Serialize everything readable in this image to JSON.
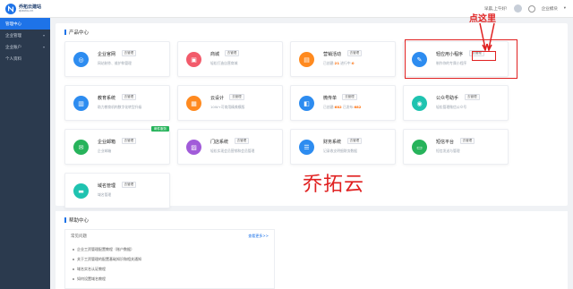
{
  "header": {
    "logo_cn": "乔拓云建站",
    "logo_en": "qiaotu.cn",
    "greeting": "早晨,上午好!",
    "account_menu": "企业模块"
  },
  "sidebar": {
    "items": [
      {
        "label": "管理中心",
        "active": true
      },
      {
        "label": "企业管理",
        "active": false
      },
      {
        "label": "企业账户",
        "active": false
      },
      {
        "label": "个人资料",
        "active": false
      }
    ]
  },
  "product_center": {
    "title": "产品中心",
    "cards": [
      {
        "name": "企业官网",
        "tag": "去管理",
        "sub": "网站制作、维护和管理",
        "icon": "globe-icon",
        "color": "#2d8cf0"
      },
      {
        "name": "商城",
        "tag": "去管理",
        "sub": "轻松打造自营商城",
        "icon": "shop-icon",
        "color": "#f25b6b"
      },
      {
        "name": "营销活动",
        "tag": "去管理",
        "sub_prefix": "已创建:",
        "sub_num1": "21",
        "sub_mid": "  进行中:",
        "sub_num2": "0",
        "icon": "chart-icon",
        "color": "#ff8a1f"
      },
      {
        "name": "轻应用小程序",
        "tag": "去管理",
        "sub": "制作你的专属小程序",
        "icon": "mini-app-icon",
        "color": "#2d8cf0"
      },
      {
        "name": "教育系统",
        "tag": "去管理",
        "sub": "助力教育机构数字化转型升级",
        "icon": "book-icon",
        "color": "#2d8cf0"
      },
      {
        "name": "云设计",
        "tag": "去管理",
        "sub": "10W+可商用精美模版",
        "icon": "design-icon",
        "color": "#ff8a1f"
      },
      {
        "name": "微传单",
        "tag": "去管理",
        "sub_prefix": "已创建:",
        "sub_num1": "682",
        "sub_mid": "  已发布:",
        "sub_num2": "682",
        "icon": "flyer-icon",
        "color": "#2d8cf0"
      },
      {
        "name": "公众号助手",
        "tag": "去管理",
        "sub": "轻松管理微信公众号",
        "icon": "wechat-icon",
        "color": "#1fc3b0"
      },
      {
        "name": "企业邮箱",
        "tag": "去管理",
        "sub": "企业邮箱",
        "icon": "mail-icon",
        "color": "#27b35b",
        "badge": "邮件服务"
      },
      {
        "name": "门店系统",
        "tag": "去管理",
        "sub": "轻松实现会员营销和会员管理",
        "icon": "store-icon",
        "color": "#a15bd9"
      },
      {
        "name": "财务系统",
        "tag": "去管理",
        "sub": "记录收支明细财务数据",
        "icon": "list-icon",
        "color": "#2d8cf0"
      },
      {
        "name": "短信平台",
        "tag": "去管理",
        "sub": "短信发送与管理",
        "icon": "sms-icon",
        "color": "#27b35b"
      },
      {
        "name": "域名管理",
        "tag": "去管理",
        "sub": "域名管理",
        "icon": "domain-icon",
        "color": "#1fc3b0"
      }
    ]
  },
  "annotation": {
    "text": "点这里",
    "watermark": "乔拓云",
    "color": "#e02020"
  },
  "help_center": {
    "title": "帮助中心",
    "box_title": "常见问题",
    "more": "查看更多>>",
    "items": [
      "企业工资管理配置教程（账户数据）",
      "关于工资管理的配置基础知识和相关通知",
      "域名实名认证教程",
      "如何设置域名教程"
    ]
  }
}
